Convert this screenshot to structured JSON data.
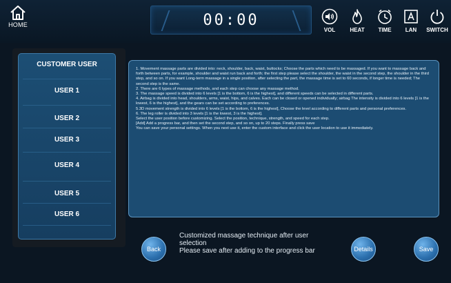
{
  "header": {
    "home_label": "HOME",
    "timer": "00:00",
    "controls": [
      {
        "label": "VOL",
        "icon": "volume-icon"
      },
      {
        "label": "HEAT",
        "icon": "flame-icon"
      },
      {
        "label": "TIME",
        "icon": "clock-icon"
      },
      {
        "label": "LAN",
        "icon": "language-icon"
      },
      {
        "label": "SWITCH",
        "icon": "power-icon"
      }
    ]
  },
  "sidebar": {
    "title": "CUSTOMER USER",
    "items": [
      {
        "label": "USER 1"
      },
      {
        "label": "USER 2"
      },
      {
        "label": "USER 3"
      },
      {
        "label": "USER 4"
      },
      {
        "label": "USER 5"
      },
      {
        "label": "USER 6"
      }
    ]
  },
  "info": {
    "lines": [
      "1. Movement massage parts are divided into: neck, shoulder, back, waist, buttocks; Choose the parts which need to be massaged. If you want to massage back and forth between parts, for example, shoulder and waist run back and forth; the first step please select the shoulder, the waist in the second step, the shoulder in the third step, and so on. If you want Long-term massage in a single position, after selecting the part, the massage time is set to 60 seconds, if longer time is needed; The second step is the same.",
      "2. There are 6 types of massage methods, and each step can choose any massage method.",
      "3. The massage speed is divided into 6 levels [1 is the bottom, 6 is the highest], and different speeds can be selected in different parts.",
      "4. Airbag is divided into head, shoulders, arms, waist, hips, and calves. Each can be closed or opened individually; airbag The intensity is divided into 6 levels [1 is the lowest, 6 is the highest], and the gears can be set according to preferences.",
      "5.3D movement strength is divided into 6 levels [1 is the bottom, 6 is the highest], Choose the level according to different parts and personal preferences.",
      "6. The leg roller is divided into 3 levels [1 is the lowest, 3 is the highest].",
      "Select the user position before customizing. Select the position, technique, strength, and speed for each step.",
      "[Add] Add a progress bar, and then set the second step, and so on, up to 20 steps. Finally press save",
      "You can save your personal settings. When you next use it, enter the custom interface and click the user location to use it immediately."
    ]
  },
  "footer": {
    "back_label": "Back",
    "details_label": "Details",
    "save_label": "Save",
    "hint_line1": "Customized massage technique after user",
    "hint_line2": "selection",
    "hint_line3": "Please save after adding to the progress bar"
  },
  "colors": {
    "background": "#0b1622",
    "panel": "#1c4c72",
    "accent": "#2b6fad"
  }
}
